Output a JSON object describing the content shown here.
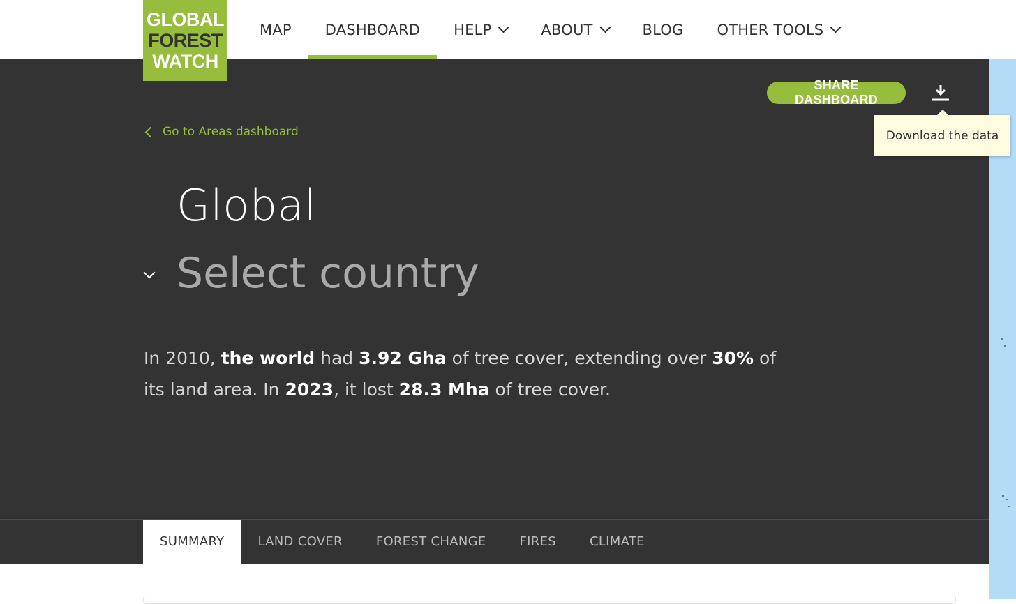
{
  "logo": {
    "line1": "GLOBAL",
    "line2": "FOREST",
    "line3": "WATCH"
  },
  "nav": {
    "items": [
      {
        "label": "MAP",
        "dropdown": false,
        "active": false
      },
      {
        "label": "DASHBOARD",
        "dropdown": false,
        "active": true
      },
      {
        "label": "HELP",
        "dropdown": true,
        "active": false
      },
      {
        "label": "ABOUT",
        "dropdown": true,
        "active": false
      },
      {
        "label": "BLOG",
        "dropdown": false,
        "active": false
      },
      {
        "label": "OTHER TOOLS",
        "dropdown": true,
        "active": false
      }
    ]
  },
  "header": {
    "share_label": "SHARE DASHBOARD",
    "download_tooltip": "Download the data",
    "back_label": "Go to Areas dashboard",
    "title": "Global",
    "select_placeholder": "Select country"
  },
  "summary": {
    "p1": "In 2010, ",
    "b1": "the world",
    "p2": " had ",
    "b2": "3.92 Gha",
    "p3": " of tree cover, extending over ",
    "b3": "30%",
    "p4": " of its land area. In ",
    "b4": "2023",
    "p5": ", it lost ",
    "b5": "28.3 Mha",
    "p6": " of tree cover."
  },
  "tabs": [
    {
      "label": "SUMMARY",
      "active": true
    },
    {
      "label": "LAND COVER",
      "active": false
    },
    {
      "label": "FOREST CHANGE",
      "active": false
    },
    {
      "label": "FIRES",
      "active": false
    },
    {
      "label": "CLIMATE",
      "active": false
    }
  ],
  "colors": {
    "brand_green": "#97bd3d",
    "hero_bg": "#333333",
    "tooltip_bg": "#fffbe0",
    "map_water": "#b3dcf7"
  },
  "icons": {
    "download": "download-icon",
    "back": "chevron-left-icon",
    "select": "chevron-down-icon"
  }
}
